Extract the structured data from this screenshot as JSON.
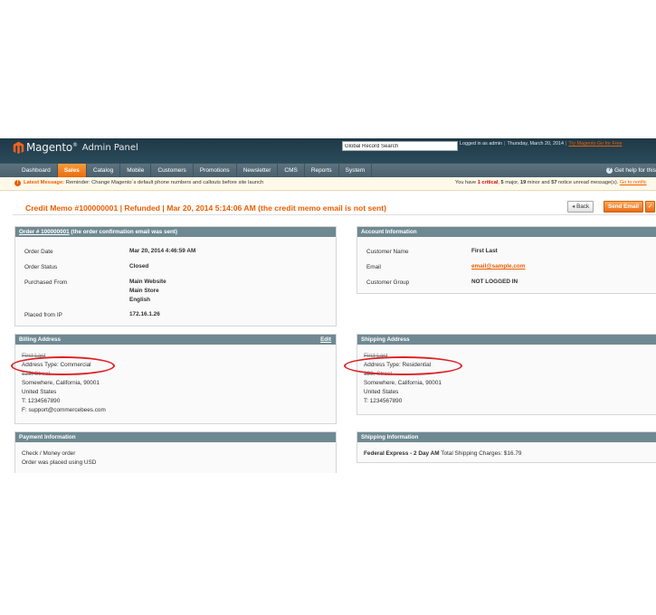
{
  "header": {
    "logo": "Magento",
    "subtitle": "Admin Panel",
    "search_value": "Global Record Search",
    "logged_in": "Logged in as admin",
    "date": "Thursday, March 20, 2014",
    "go_link": "Try Magento Go for Free"
  },
  "nav": {
    "items": [
      "Dashboard",
      "Sales",
      "Catalog",
      "Mobile",
      "Customers",
      "Promotions",
      "Newsletter",
      "CMS",
      "Reports",
      "System"
    ],
    "active": "Sales",
    "help": "Get help for this"
  },
  "notice": {
    "label": "Latest Message:",
    "text": "Reminder: Change Magento`s default phone numbers and callouts before site launch",
    "summary_prefix": "You have",
    "critical": "1 critical",
    "major": "5",
    "major_label": "major,",
    "minor": "19",
    "minor_label": "minor and",
    "notice_count": "57",
    "notice_label": "notice unread message(s).",
    "go_link": "Go to notific"
  },
  "page": {
    "title": "Credit Memo #100000001 | Refunded | Mar 20, 2014 5:14:06 AM (the credit memo email is not sent)",
    "back_label": "Back",
    "send_email_label": "Send Email"
  },
  "order_box": {
    "title_link": "Order # 100000001",
    "title_rest": "(the order confirmation email was sent)",
    "rows": [
      {
        "label": "Order Date",
        "value": [
          "Mar 20, 2014 4:46:59 AM"
        ]
      },
      {
        "label": "Order Status",
        "value": [
          "Closed"
        ]
      },
      {
        "label": "Purchased From",
        "value": [
          "Main Website",
          "Main Store",
          "English"
        ]
      },
      {
        "label": "Placed from IP",
        "value": [
          "172.16.1.26"
        ]
      }
    ]
  },
  "account_box": {
    "title": "Account Information",
    "rows": [
      {
        "label": "Customer Name",
        "value": "First Last"
      },
      {
        "label": "Email",
        "value": "email@sample.com"
      },
      {
        "label": "Customer Group",
        "value": "NOT LOGGED IN"
      }
    ]
  },
  "billing_box": {
    "title": "Billing Address",
    "edit_label": "Edit",
    "lines": [
      "First Last",
      "Address Type: Commercial",
      "123, Street",
      "Somewhere, California, 90001",
      "United States",
      "T: 1234567890",
      "F: support@commercebees.com"
    ]
  },
  "shipping_box": {
    "title": "Shipping Address",
    "lines": [
      "First Last",
      "Address Type: Residential",
      "123, Street",
      "Somewhere, California, 90001",
      "United States",
      "T: 1234567890"
    ]
  },
  "payment_box": {
    "title": "Payment Information",
    "lines": [
      "Check / Money order",
      "Order was placed using USD"
    ]
  },
  "shipping_info_box": {
    "title": "Shipping Information",
    "method": "Federal Express - 2 Day AM",
    "charges": "Total Shipping Charges: $16.79"
  },
  "colors": {
    "accent": "#eb5e00",
    "header": "#2a4b5b",
    "box_head": "#6f8992",
    "annotation": "#e01e24"
  }
}
